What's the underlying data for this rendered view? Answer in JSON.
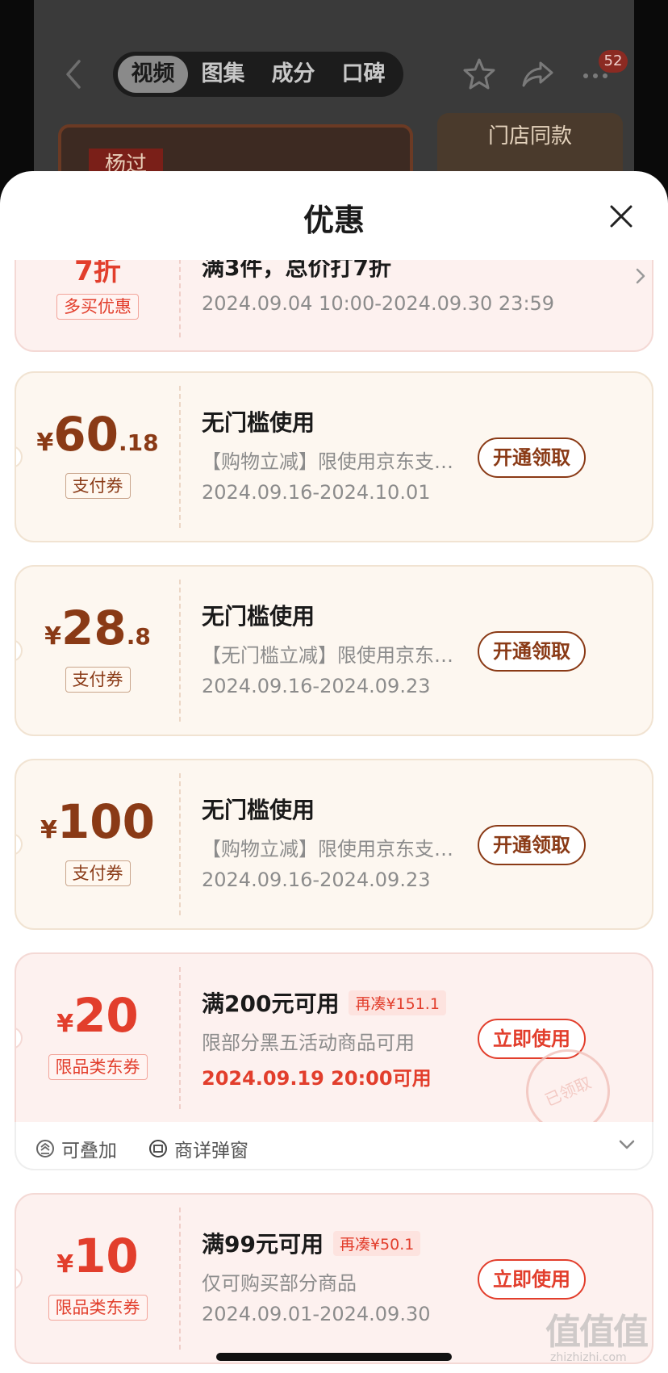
{
  "background": {
    "tabs": [
      "视频",
      "图集",
      "成分",
      "口碑"
    ],
    "active_tab": 0,
    "badge_count": "52",
    "banner_left_logo": "杨过",
    "banner_right_text": "门店同款"
  },
  "sheet": {
    "title": "优惠"
  },
  "coupons": [
    {
      "type": "discount",
      "amount_int": "7折",
      "tag": "多买优惠",
      "title": "满3件，总价打7折",
      "date": "2024.09.04 10:00-2024.09.30 23:59"
    },
    {
      "type": "pay",
      "currency": "¥",
      "amount_int": "60",
      "amount_dec": ".18",
      "tag": "支付券",
      "title": "无门槛使用",
      "desc": "【购物立减】限使用京东支付…",
      "date": "2024.09.16-2024.10.01",
      "button": "开通领取"
    },
    {
      "type": "pay",
      "currency": "¥",
      "amount_int": "28",
      "amount_dec": ".8",
      "tag": "支付券",
      "title": "无门槛使用",
      "desc": "【无门槛立减】限使用京东支付…",
      "date": "2024.09.16-2024.09.23",
      "button": "开通领取"
    },
    {
      "type": "pay",
      "currency": "¥",
      "amount_int": "100",
      "amount_dec": "",
      "tag": "支付券",
      "title": "无门槛使用",
      "desc": "【购物立减】限使用京东支付…",
      "date": "2024.09.16-2024.09.23",
      "button": "开通领取"
    },
    {
      "type": "category",
      "currency": "¥",
      "amount_int": "20",
      "amount_dec": "",
      "tag": "限品类东券",
      "title": "满200元可用",
      "gap": "再凑¥151.1",
      "desc": "限部分黑五活动商品可用",
      "date": "2024.09.19 20:00可用",
      "button": "立即使用",
      "stamp": "已领取",
      "extras": [
        "可叠加",
        "商详弹窗"
      ]
    },
    {
      "type": "category",
      "currency": "¥",
      "amount_int": "10",
      "amount_dec": "",
      "tag": "限品类东券",
      "title": "满99元可用",
      "gap": "再凑¥50.1",
      "desc": "仅可购买部分商品",
      "date": "2024.09.01-2024.09.30",
      "button": "立即使用"
    }
  ],
  "watermark": {
    "text": "值值值",
    "sub": "zhizhizhi.com"
  }
}
